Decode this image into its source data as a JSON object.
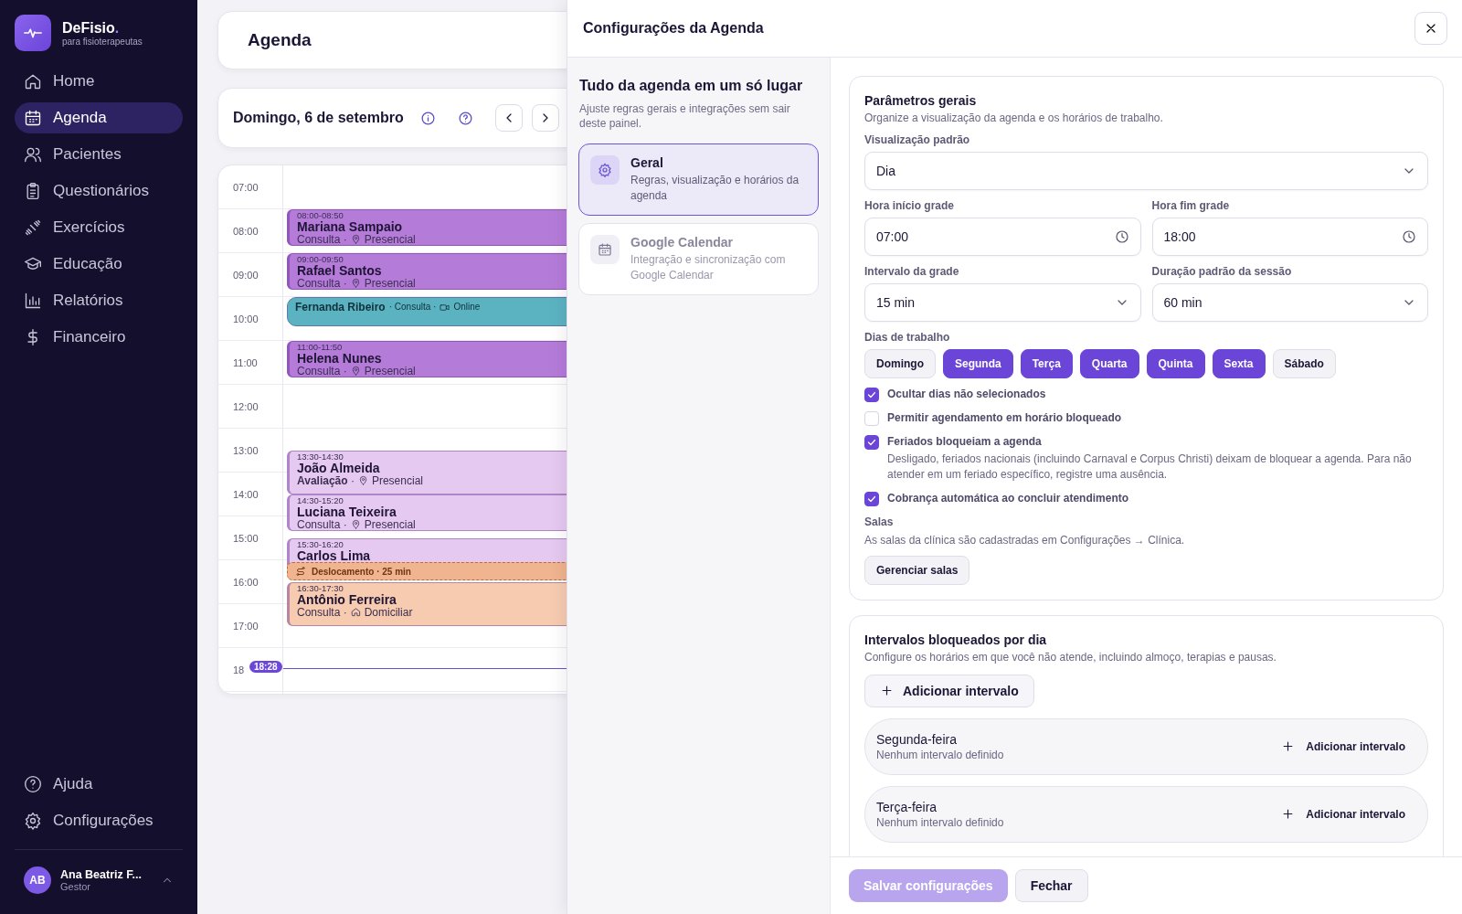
{
  "brand": {
    "name": "DeFisio",
    "dot": ".",
    "tagline": "para fisioterapeutas"
  },
  "sidebar": {
    "items": [
      {
        "label": "Home",
        "selected": false
      },
      {
        "label": "Agenda",
        "selected": true
      },
      {
        "label": "Pacientes",
        "selected": false
      },
      {
        "label": "Questionários",
        "selected": false
      },
      {
        "label": "Exercícios",
        "selected": false
      },
      {
        "label": "Educação",
        "selected": false
      },
      {
        "label": "Relatórios",
        "selected": false
      },
      {
        "label": "Financeiro",
        "selected": false
      }
    ],
    "footer_items": [
      {
        "label": "Ajuda",
        "selected": false
      },
      {
        "label": "Configurações",
        "selected": false
      }
    ],
    "user": {
      "initials": "AB",
      "name": "Ana Beatriz F...",
      "role": "Gestor"
    }
  },
  "page": {
    "title": "Agenda",
    "date": "Domingo, 6 de setembro"
  },
  "calendar": {
    "hours": [
      "07:00",
      "08:00",
      "09:00",
      "10:00",
      "11:00",
      "12:00",
      "13:00",
      "14:00",
      "15:00",
      "16:00",
      "17:00",
      "18"
    ],
    "now": "18:28",
    "events": [
      {
        "kind": "block",
        "time": "08:00-08:50",
        "name": "Mariana Sampaio",
        "type": "Consulta ·",
        "mode": "Presencial",
        "color": "#b57bd9"
      },
      {
        "kind": "block",
        "time": "09:00-09:50",
        "name": "Rafael Santos",
        "type": "Consulta ·",
        "mode": "Presencial",
        "color": "#b57bd9"
      },
      {
        "kind": "compact",
        "name": "Fernanda Ribeiro",
        "type": "· Consulta ·",
        "mode": "Online",
        "color": "#5bb3c2"
      },
      {
        "kind": "block",
        "time": "11:00-11:50",
        "name": "Helena Nunes",
        "type": "Consulta ·",
        "mode": "Presencial",
        "color": "#b57bd9"
      },
      {
        "kind": "block",
        "time": "13:30-14:30",
        "name": "João Almeida",
        "type": "**Avaliação** ·",
        "mode": "Presencial",
        "color": "#e6c9f1"
      },
      {
        "kind": "block",
        "time": "14:30-15:20",
        "name": "Luciana Teixeira",
        "type": "Consulta ·",
        "mode": "Presencial",
        "color": "#e6c9f1"
      },
      {
        "kind": "block",
        "time": "15:30-16:20",
        "name": "Carlos Lima",
        "color": "#e6c9f1"
      },
      {
        "kind": "travel",
        "label": "Deslocamento · 25 min",
        "color": "#f0b48e"
      },
      {
        "kind": "block",
        "time": "16:30-17:30",
        "name": "Antônio Ferreira",
        "type": "Consulta ·",
        "mode": "Domiciliar",
        "color": "#f6cbb0"
      }
    ]
  },
  "drawer": {
    "title": "Configurações da Agenda",
    "intro": {
      "title": "Tudo da agenda em um só lugar",
      "text": "Ajuste regras gerais e integrações sem sair deste painel."
    },
    "nav": [
      {
        "title": "Geral",
        "text": "Regras, visualização e horários da agenda",
        "selected": true
      },
      {
        "title": "Google Calendar",
        "text": "Integração e sincronização com Google Calendar",
        "selected": false
      }
    ],
    "general": {
      "title": "Parâmetros gerais",
      "subtitle": "Organize a visualização da agenda e os horários de trabalho.",
      "view_field": {
        "label": "Visualização padrão",
        "value": "Dia",
        "kind": "select"
      },
      "fields": [
        {
          "label": "Hora início grade",
          "value": "07:00",
          "kind": "time"
        },
        {
          "label": "Hora fim grade",
          "value": "18:00",
          "kind": "time"
        },
        {
          "label": "Intervalo da grade",
          "value": "15 min",
          "kind": "select"
        },
        {
          "label": "Duração padrão da sessão",
          "value": "60 min",
          "kind": "select"
        }
      ],
      "days_label": "Dias de trabalho",
      "days": [
        {
          "label": "Domingo",
          "selected": false
        },
        {
          "label": "Segunda",
          "selected": true
        },
        {
          "label": "Terça",
          "selected": true
        },
        {
          "label": "Quarta",
          "selected": true
        },
        {
          "label": "Quinta",
          "selected": true
        },
        {
          "label": "Sexta",
          "selected": true
        },
        {
          "label": "Sábado",
          "selected": false
        }
      ],
      "options": [
        {
          "label": "Ocultar dias não selecionados",
          "checked": true
        },
        {
          "label": "Permitir agendamento em horário bloqueado",
          "checked": false
        },
        {
          "label": "Feriados bloqueiam a agenda",
          "checked": true,
          "help": "Desligado, feriados nacionais (incluindo Carnaval e Corpus Christi) deixam de bloquear a agenda. Para não atender em um feriado específico, registre uma ausência."
        },
        {
          "label": "Cobrança automática ao concluir atendimento",
          "checked": true
        }
      ],
      "rooms": {
        "label": "Salas",
        "text": "As salas da clínica são cadastradas em Configurações → Clínica.",
        "button": "Gerenciar salas"
      }
    },
    "blocked": {
      "title": "Intervalos bloqueados por dia",
      "subtitle": "Configure os horários em que você não atende, incluindo almoço, terapias e pausas.",
      "add_button": "Adicionar intervalo",
      "days": [
        {
          "day": "Segunda-feira",
          "status": "Nenhum intervalo definido",
          "button": "Adicionar intervalo"
        },
        {
          "day": "Terça-feira",
          "status": "Nenhum intervalo definido",
          "button": "Adicionar intervalo"
        }
      ]
    },
    "footer": {
      "save": {
        "label": "Salvar configurações",
        "disabled": true
      },
      "close": "Fechar"
    }
  }
}
